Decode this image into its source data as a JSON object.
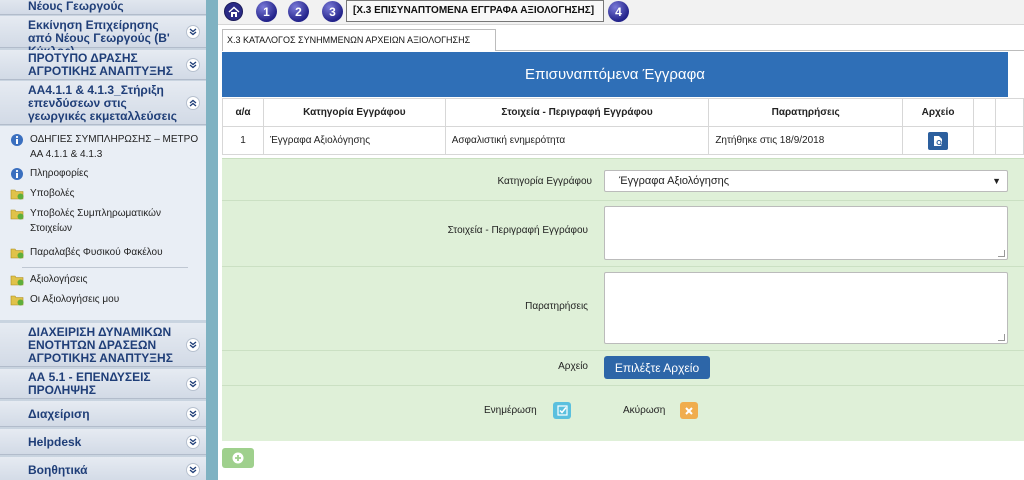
{
  "sidebar": {
    "sections": [
      {
        "label": "Νέους Γεωργούς"
      },
      {
        "label": "Εκκίνηση Επιχείρησης από Νέους Γεωργούς (Β' Κύκλος)"
      },
      {
        "label": "ΠΡΟΤΥΠΟ ΔΡΑΣΗΣ ΑΓΡΟΤΙΚΗΣ ΑΝΑΠΤΥΞΗΣ"
      },
      {
        "label": "ΑΑ4.1.1 & 4.1.3_Στήριξη επενδύσεων στις γεωργικές εκμεταλλεύσεις"
      },
      {
        "label": "ΔΙΑΧΕΙΡΙΣΗ ΔΥΝΑΜΙΚΩΝ ΕΝΟΤΗΤΩΝ ΔΡΑΣΕΩΝ ΑΓΡΟΤΙΚΗΣ ΑΝΑΠΤΥΞΗΣ"
      },
      {
        "label": "ΑΑ 5.1 - ΕΠΕΝΔΥΣΕΙΣ ΠΡΟΛΗΨΗΣ"
      },
      {
        "label": "Διαχείριση"
      },
      {
        "label": "Helpdesk"
      },
      {
        "label": "Βοηθητικά"
      }
    ],
    "menu": [
      {
        "label": "ΟΔΗΓΙΕΣ ΣΥΜΠΛΗΡΩΣΗΣ – ΜΕΤΡΟ ΑΑ 4.1.1 & 4.1.3",
        "icon": "info-icon"
      },
      {
        "label": "Πληροφορίες",
        "icon": "info-icon"
      },
      {
        "label": "Υποβολές",
        "icon": "folder-icon"
      },
      {
        "label": "Υποβολές Συμπληρωματικών Στοιχείων",
        "icon": "folder-icon"
      },
      {
        "label": "Παραλαβές Φυσικού Φακέλου",
        "icon": "folder-icon"
      },
      {
        "label": "Αξιολογήσεις",
        "icon": "folder-icon"
      },
      {
        "label": "Οι Αξιολογήσεις μου",
        "icon": "folder-icon"
      }
    ]
  },
  "topbar": {
    "steps": [
      "1",
      "2",
      "3",
      "4"
    ],
    "breadcrumb": "[Χ.3 ΕΠΙΣΥΝΑΠΤΟΜΕΝΑ ΕΓΓΡΑΦΑ ΑΞΙΟΛΟΓΗΣΗΣ]"
  },
  "tab": {
    "label": "Χ.3 ΚΑΤΑΛΟΓΟΣ ΣΥΝΗΜΜΕΝΩΝ ΑΡΧΕΙΩΝ ΑΞΙΟΛΟΓΗΣΗΣ"
  },
  "panel": {
    "title": "Επισυναπτόμενα Έγγραφα"
  },
  "table": {
    "headers": [
      "α/α",
      "Κατηγορία Εγγράφου",
      "Στοιχεία - Περιγραφή Εγγράφου",
      "Παρατηρήσεις",
      "Αρχείο"
    ],
    "rows": [
      {
        "num": "1",
        "category": "Έγγραφα Αξιολόγησης",
        "description": "Ασφαλιστική ενημερότητα",
        "notes": "Ζητήθηκε στις 18/9/2018"
      }
    ]
  },
  "form": {
    "category_label": "Κατηγορία Εγγράφου",
    "category_value": "Έγγραφα Αξιολόγησης",
    "description_label": "Στοιχεία - Περιγραφή Εγγράφου",
    "description_value": "",
    "notes_label": "Παρατηρήσεις",
    "notes_value": "",
    "file_label": "Αρχείο",
    "file_button": "Επιλέξτε Αρχείο",
    "update_label": "Ενημέρωση",
    "cancel_label": "Ακύρωση"
  },
  "colors": {
    "panel_header": "#2f6fb7",
    "form_bg": "#dff0d8",
    "update": "#5bc0de",
    "cancel": "#f0ad4e",
    "add": "#9fd08d"
  }
}
